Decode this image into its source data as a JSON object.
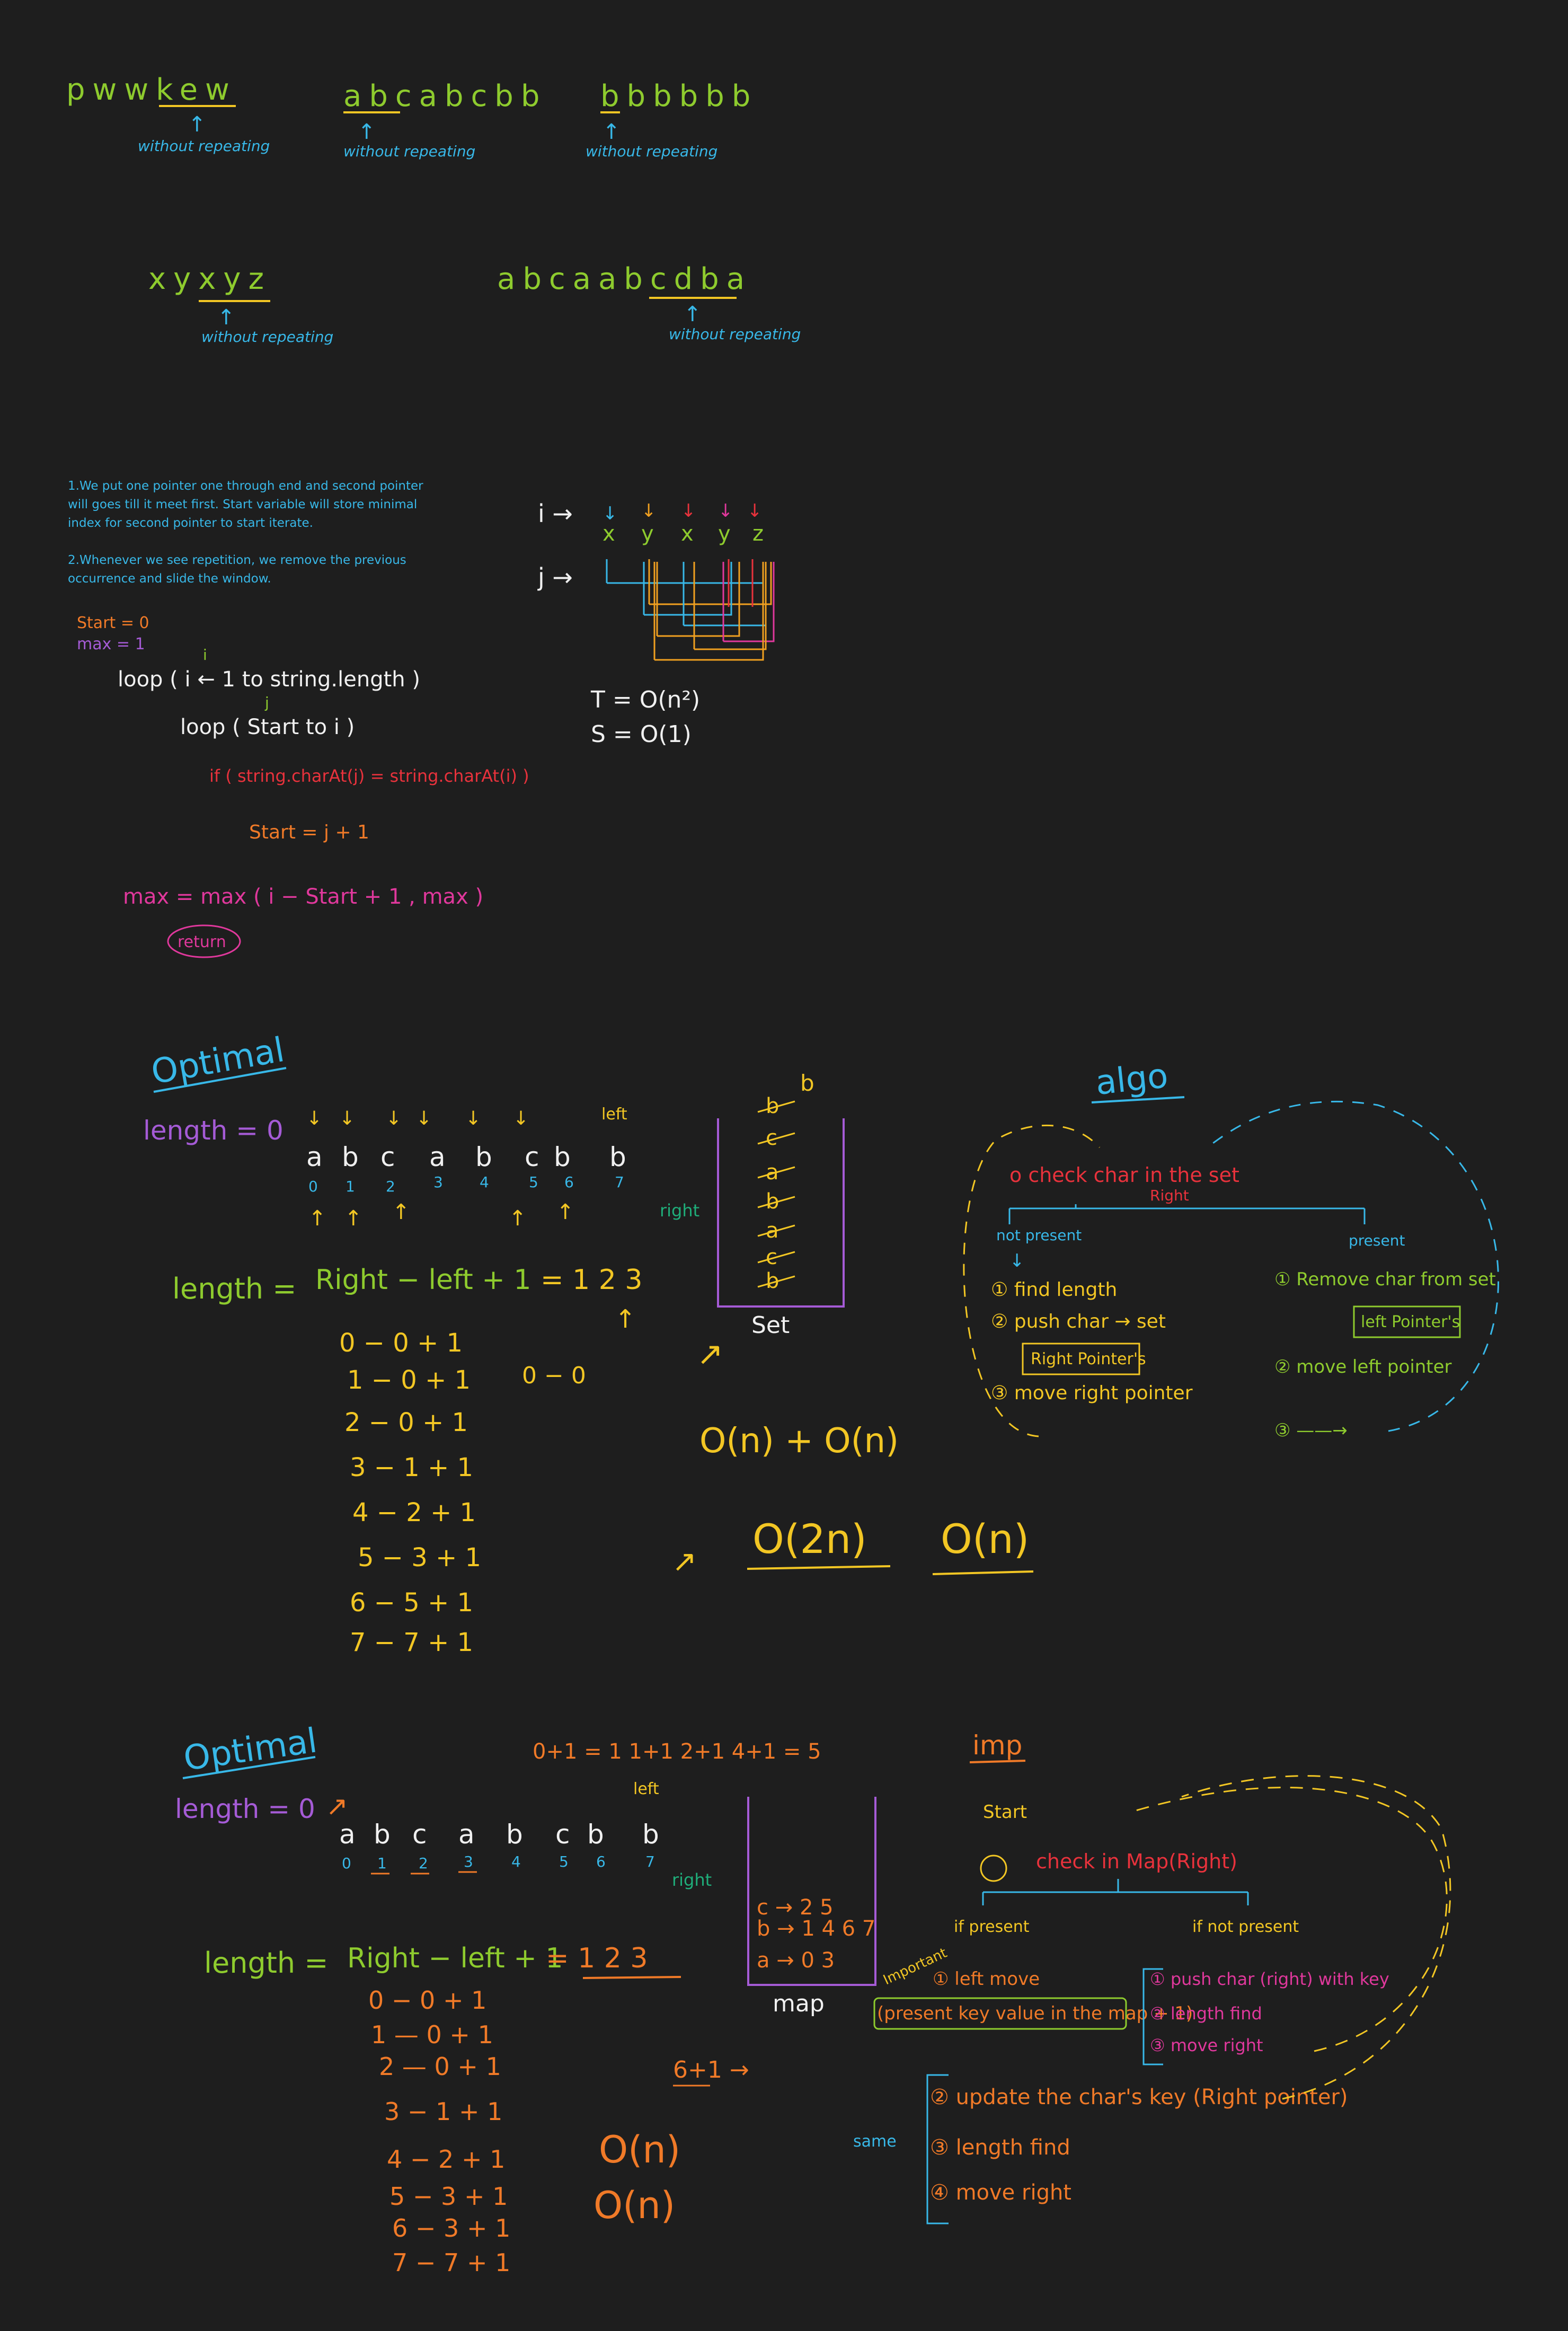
{
  "colors": {
    "background": "#1e1e1e",
    "green": "#8ecb2e",
    "blue": "#38b8e8",
    "orange": "#f0a020",
    "red": "#e8323c",
    "pink": "#e0389c",
    "purple": "#a55bd6",
    "yellow": "#f2c624",
    "white": "#f0f0f0",
    "deeporange": "#f07a28",
    "teal": "#1fae7a"
  },
  "examples": {
    "strings": [
      "pwwkew",
      "abcabcbb",
      "bbbbbb",
      "xyxyz",
      "abcaabcdba"
    ],
    "caption": "without repeating"
  },
  "brute": {
    "note1": "1.We put one pointer one through end and second pointer will goes till it meet first. Start variable will store minimal index for second pointer to start iterate.",
    "note2": "2.Whenever we see repetition, we remove the previous occurrence and slide the window.",
    "start_init": "Start = 0",
    "max_init": "max = 1",
    "loop1": "loop ( i ← 1  to  string.length )",
    "loop1_small": "i",
    "loop2": "loop ( Start  to  i )",
    "loop2_small": "j",
    "if_line": "if ( string.charAt(j) = string.charAt(i) )",
    "start_update": "Start = j + 1",
    "max_update": "max =  max ( i − Start + 1 ,  max )",
    "return": "return",
    "i_label": "i →",
    "j_label": "j →",
    "trace_letters": [
      "x",
      "y",
      "x",
      "y",
      "z"
    ],
    "time": "T = O(n²)",
    "space": "S = O(1)"
  },
  "optimal1": {
    "title": "Optimal",
    "length_init": "length = 0",
    "letters": [
      "a",
      "b",
      "c",
      "a",
      "b",
      "c",
      "b",
      "b"
    ],
    "indices": [
      "0",
      "1",
      "2",
      "3",
      "4",
      "5",
      "6",
      "7"
    ],
    "left": "left",
    "right": "right",
    "formula_label": "length =",
    "formula": "Right − left + 1",
    "formula_result": "= 1 2 3",
    "rows": [
      "0 −  0 + 1",
      "1 −  0 + 1",
      "2 −  0 + 1",
      "3 −  1 + 1",
      "4 −  2 + 1",
      "5 −  3 + 1",
      "6 −  5 + 1",
      "7 −  7 + 1"
    ],
    "side_note": "0 − 0",
    "set_top": "b",
    "set_items": [
      "b",
      "c",
      "a",
      "b",
      "a",
      "c",
      "b"
    ],
    "set_label": "Set",
    "complexity1": "O(n) + O(n)",
    "complexity2": "O(2n)",
    "complexity3": "O(n)",
    "algo_title": "algo",
    "check": "o check char in the set",
    "check_right": "Right",
    "not_present": "not present",
    "present": "present",
    "np_steps": [
      "① find length",
      "② push char → set",
      "③ move right pointer"
    ],
    "np_box": "Right Pointer's",
    "p_steps": [
      "① Remove char from set",
      "② move left pointer",
      "③ ——→"
    ],
    "p_box": "left Pointer's"
  },
  "optimal2": {
    "title": "Optimal",
    "length_init": "length = 0",
    "top_sum": "0+1 = 1   1+1   2+1   4+1  = 5",
    "letters": [
      "a",
      "b",
      "c",
      "a",
      "b",
      "c",
      "b",
      "b"
    ],
    "indices": [
      "0",
      "1",
      "2",
      "3",
      "4",
      "5",
      "6",
      "7"
    ],
    "left": "left",
    "right": "right",
    "formula_label": "length =",
    "formula": "Right − left + 1",
    "formula_result": "= 1 2 3",
    "rows": [
      "0  −  0 + 1",
      "1  —  0 + 1",
      "2 —  0 + 1",
      "3 −  1 + 1",
      "4 − 2 + 1",
      "5 − 3 + 1",
      "6 − 3 + 1",
      "7 − 7 + 1"
    ],
    "side_calc": "6+1 →",
    "map_rows": [
      "c → 2 5",
      "b → 1 4 6 7",
      "a → 0 3"
    ],
    "map_label": "map",
    "complexity1": "O(n)",
    "complexity2": "O(n)",
    "imp": "imp",
    "start": "Start",
    "check": "check  in  Map(Right)",
    "if_present": "if present",
    "if_not_present": "if not present",
    "important": "Important",
    "p_steps": [
      "① left move",
      "(present key value in the map + 1)"
    ],
    "np_steps": [
      "① push char (right) with key",
      "② length find",
      "③ move right"
    ],
    "same_label": "same",
    "same_steps": [
      "② update the char's key (Right pointer)",
      "③ length  find",
      "④ move  right"
    ]
  }
}
